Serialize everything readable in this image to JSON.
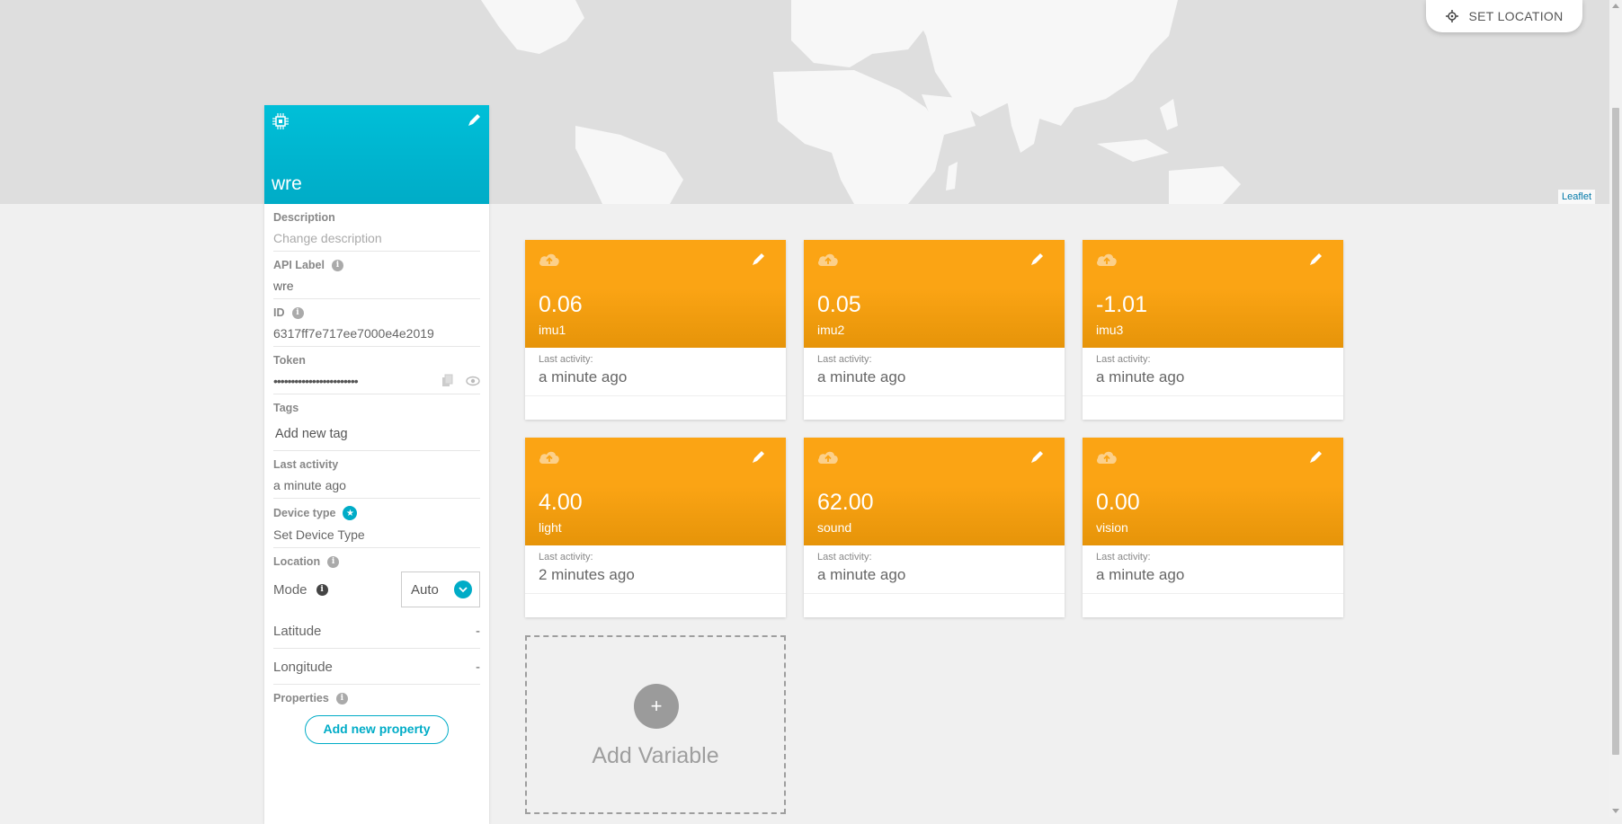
{
  "map": {
    "attribution": "Leaflet",
    "set_location_label": "SET LOCATION"
  },
  "device": {
    "name": "wre",
    "description_label": "Description",
    "description_placeholder": "Change description",
    "api_label_label": "API Label",
    "api_label_value": "wre",
    "id_label": "ID",
    "id_value": "6317ff7e717ee7000e4e2019",
    "token_label": "Token",
    "token_value": "••••••••••••••••••••••••",
    "tags_label": "Tags",
    "tags_placeholder": "Add new tag",
    "last_activity_label": "Last activity",
    "last_activity_value": "a minute ago",
    "device_type_label": "Device type",
    "device_type_placeholder": "Set Device Type",
    "location_label": "Location",
    "mode_label": "Mode",
    "mode_value": "Auto",
    "latitude_label": "Latitude",
    "latitude_value": "-",
    "longitude_label": "Longitude",
    "longitude_value": "-",
    "properties_label": "Properties",
    "add_property_label": "Add new property"
  },
  "variables": [
    {
      "value": "0.06",
      "name": "imu1",
      "last_activity_label": "Last activity:",
      "last_activity": "a minute ago"
    },
    {
      "value": "0.05",
      "name": "imu2",
      "last_activity_label": "Last activity:",
      "last_activity": "a minute ago"
    },
    {
      "value": "-1.01",
      "name": "imu3",
      "last_activity_label": "Last activity:",
      "last_activity": "a minute ago"
    },
    {
      "value": "4.00",
      "name": "light",
      "last_activity_label": "Last activity:",
      "last_activity": "2 minutes ago"
    },
    {
      "value": "62.00",
      "name": "sound",
      "last_activity_label": "Last activity:",
      "last_activity": "a minute ago"
    },
    {
      "value": "0.00",
      "name": "vision",
      "last_activity_label": "Last activity:",
      "last_activity": "a minute ago"
    }
  ],
  "add_variable": {
    "plus": "+",
    "label": "Add Variable"
  },
  "colors": {
    "device_accent": "#00acc7",
    "variable_accent": "#fba414"
  }
}
